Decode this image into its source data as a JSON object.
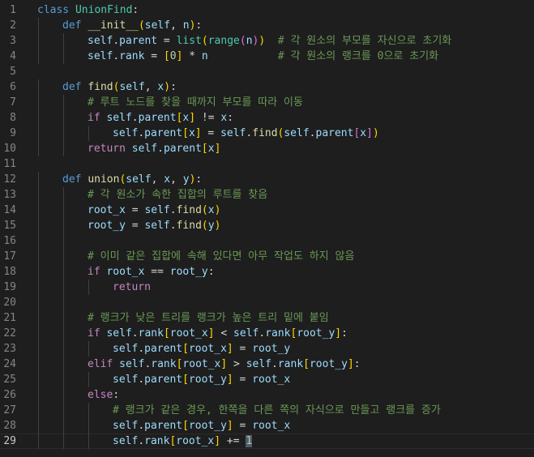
{
  "colors": {
    "background": "#1e1e1e",
    "line_number": "#858585",
    "keyword": "#569cd6",
    "control_keyword": "#c586c0",
    "function": "#dcdcaa",
    "class_name": "#4ec9b0",
    "variable": "#9cdcfe",
    "number": "#b5cea8",
    "comment": "#6a9955",
    "bracket_1": "#ffd700",
    "bracket_2": "#da70d6",
    "bracket_3": "#179fff"
  },
  "current_line": 29,
  "lines": [
    {
      "n": "1",
      "indent": 0,
      "tokens": [
        [
          "kw",
          "class"
        ],
        [
          "op",
          " "
        ],
        [
          "cls",
          "UnionFind"
        ],
        [
          "op",
          ":"
        ]
      ]
    },
    {
      "n": "2",
      "indent": 1,
      "tokens": [
        [
          "kw",
          "def"
        ],
        [
          "op",
          " "
        ],
        [
          "fn",
          "__init__"
        ],
        [
          "b1",
          "("
        ],
        [
          "var",
          "self"
        ],
        [
          "op",
          ", "
        ],
        [
          "var",
          "n"
        ],
        [
          "b1",
          ")"
        ],
        [
          "op",
          ":"
        ]
      ]
    },
    {
      "n": "3",
      "indent": 2,
      "tokens": [
        [
          "var",
          "self"
        ],
        [
          "op",
          "."
        ],
        [
          "var",
          "parent"
        ],
        [
          "op",
          " = "
        ],
        [
          "cls",
          "list"
        ],
        [
          "b1",
          "("
        ],
        [
          "cls",
          "range"
        ],
        [
          "b2",
          "("
        ],
        [
          "var",
          "n"
        ],
        [
          "b2",
          ")"
        ],
        [
          "b1",
          ")"
        ],
        [
          "op",
          "  "
        ],
        [
          "cm",
          "# 각 원소의 부모를 자신으로 초기화"
        ]
      ]
    },
    {
      "n": "4",
      "indent": 2,
      "tokens": [
        [
          "var",
          "self"
        ],
        [
          "op",
          "."
        ],
        [
          "var",
          "rank"
        ],
        [
          "op",
          " = "
        ],
        [
          "b1",
          "["
        ],
        [
          "num",
          "0"
        ],
        [
          "b1",
          "]"
        ],
        [
          "op",
          " * "
        ],
        [
          "var",
          "n"
        ],
        [
          "op",
          "           "
        ],
        [
          "cm",
          "# 각 원소의 랭크를 0으로 초기화"
        ]
      ]
    },
    {
      "n": "5",
      "indent": 0,
      "tokens": []
    },
    {
      "n": "6",
      "indent": 1,
      "tokens": [
        [
          "kw",
          "def"
        ],
        [
          "op",
          " "
        ],
        [
          "fn",
          "find"
        ],
        [
          "b1",
          "("
        ],
        [
          "var",
          "self"
        ],
        [
          "op",
          ", "
        ],
        [
          "var",
          "x"
        ],
        [
          "b1",
          ")"
        ],
        [
          "op",
          ":"
        ]
      ]
    },
    {
      "n": "7",
      "indent": 2,
      "tokens": [
        [
          "cm",
          "# 루트 노드를 찾을 때까지 부모를 따라 이동"
        ]
      ]
    },
    {
      "n": "8",
      "indent": 2,
      "tokens": [
        [
          "kwc",
          "if"
        ],
        [
          "op",
          " "
        ],
        [
          "var",
          "self"
        ],
        [
          "op",
          "."
        ],
        [
          "var",
          "parent"
        ],
        [
          "b1",
          "["
        ],
        [
          "var",
          "x"
        ],
        [
          "b1",
          "]"
        ],
        [
          "op",
          " != "
        ],
        [
          "var",
          "x"
        ],
        [
          "op",
          ":"
        ]
      ]
    },
    {
      "n": "9",
      "indent": 3,
      "tokens": [
        [
          "var",
          "self"
        ],
        [
          "op",
          "."
        ],
        [
          "var",
          "parent"
        ],
        [
          "b1",
          "["
        ],
        [
          "var",
          "x"
        ],
        [
          "b1",
          "]"
        ],
        [
          "op",
          " = "
        ],
        [
          "var",
          "self"
        ],
        [
          "op",
          "."
        ],
        [
          "fn",
          "find"
        ],
        [
          "b1",
          "("
        ],
        [
          "var",
          "self"
        ],
        [
          "op",
          "."
        ],
        [
          "var",
          "parent"
        ],
        [
          "b2",
          "["
        ],
        [
          "var",
          "x"
        ],
        [
          "b2",
          "]"
        ],
        [
          "b1",
          ")"
        ]
      ]
    },
    {
      "n": "10",
      "indent": 2,
      "tokens": [
        [
          "kwc",
          "return"
        ],
        [
          "op",
          " "
        ],
        [
          "var",
          "self"
        ],
        [
          "op",
          "."
        ],
        [
          "var",
          "parent"
        ],
        [
          "b1",
          "["
        ],
        [
          "var",
          "x"
        ],
        [
          "b1",
          "]"
        ]
      ]
    },
    {
      "n": "11",
      "indent": 0,
      "tokens": []
    },
    {
      "n": "12",
      "indent": 1,
      "tokens": [
        [
          "kw",
          "def"
        ],
        [
          "op",
          " "
        ],
        [
          "fn",
          "union"
        ],
        [
          "b1",
          "("
        ],
        [
          "var",
          "self"
        ],
        [
          "op",
          ", "
        ],
        [
          "var",
          "x"
        ],
        [
          "op",
          ", "
        ],
        [
          "var",
          "y"
        ],
        [
          "b1",
          ")"
        ],
        [
          "op",
          ":"
        ]
      ]
    },
    {
      "n": "13",
      "indent": 2,
      "tokens": [
        [
          "cm",
          "# 각 원소가 속한 집합의 루트를 찾음"
        ]
      ]
    },
    {
      "n": "14",
      "indent": 2,
      "tokens": [
        [
          "var",
          "root_x"
        ],
        [
          "op",
          " = "
        ],
        [
          "var",
          "self"
        ],
        [
          "op",
          "."
        ],
        [
          "fn",
          "find"
        ],
        [
          "b1",
          "("
        ],
        [
          "var",
          "x"
        ],
        [
          "b1",
          ")"
        ]
      ]
    },
    {
      "n": "15",
      "indent": 2,
      "tokens": [
        [
          "var",
          "root_y"
        ],
        [
          "op",
          " = "
        ],
        [
          "var",
          "self"
        ],
        [
          "op",
          "."
        ],
        [
          "fn",
          "find"
        ],
        [
          "b1",
          "("
        ],
        [
          "var",
          "y"
        ],
        [
          "b1",
          ")"
        ]
      ]
    },
    {
      "n": "16",
      "indent": 2,
      "tokens": []
    },
    {
      "n": "17",
      "indent": 2,
      "tokens": [
        [
          "cm",
          "# 이미 같은 집합에 속해 있다면 아무 작업도 하지 않음"
        ]
      ]
    },
    {
      "n": "18",
      "indent": 2,
      "tokens": [
        [
          "kwc",
          "if"
        ],
        [
          "op",
          " "
        ],
        [
          "var",
          "root_x"
        ],
        [
          "op",
          " == "
        ],
        [
          "var",
          "root_y"
        ],
        [
          "op",
          ":"
        ]
      ]
    },
    {
      "n": "19",
      "indent": 3,
      "tokens": [
        [
          "kwc",
          "return"
        ]
      ]
    },
    {
      "n": "20",
      "indent": 2,
      "tokens": []
    },
    {
      "n": "21",
      "indent": 2,
      "tokens": [
        [
          "cm",
          "# 랭크가 낮은 트리를 랭크가 높은 트리 밑에 붙임"
        ]
      ]
    },
    {
      "n": "22",
      "indent": 2,
      "tokens": [
        [
          "kwc",
          "if"
        ],
        [
          "op",
          " "
        ],
        [
          "var",
          "self"
        ],
        [
          "op",
          "."
        ],
        [
          "var",
          "rank"
        ],
        [
          "b1",
          "["
        ],
        [
          "var",
          "root_x"
        ],
        [
          "b1",
          "]"
        ],
        [
          "op",
          " < "
        ],
        [
          "var",
          "self"
        ],
        [
          "op",
          "."
        ],
        [
          "var",
          "rank"
        ],
        [
          "b1",
          "["
        ],
        [
          "var",
          "root_y"
        ],
        [
          "b1",
          "]"
        ],
        [
          "op",
          ":"
        ]
      ]
    },
    {
      "n": "23",
      "indent": 3,
      "tokens": [
        [
          "var",
          "self"
        ],
        [
          "op",
          "."
        ],
        [
          "var",
          "parent"
        ],
        [
          "b1",
          "["
        ],
        [
          "var",
          "root_x"
        ],
        [
          "b1",
          "]"
        ],
        [
          "op",
          " = "
        ],
        [
          "var",
          "root_y"
        ]
      ]
    },
    {
      "n": "24",
      "indent": 2,
      "tokens": [
        [
          "kwc",
          "elif"
        ],
        [
          "op",
          " "
        ],
        [
          "var",
          "self"
        ],
        [
          "op",
          "."
        ],
        [
          "var",
          "rank"
        ],
        [
          "b1",
          "["
        ],
        [
          "var",
          "root_x"
        ],
        [
          "b1",
          "]"
        ],
        [
          "op",
          " > "
        ],
        [
          "var",
          "self"
        ],
        [
          "op",
          "."
        ],
        [
          "var",
          "rank"
        ],
        [
          "b1",
          "["
        ],
        [
          "var",
          "root_y"
        ],
        [
          "b1",
          "]"
        ],
        [
          "op",
          ":"
        ]
      ]
    },
    {
      "n": "25",
      "indent": 3,
      "tokens": [
        [
          "var",
          "self"
        ],
        [
          "op",
          "."
        ],
        [
          "var",
          "parent"
        ],
        [
          "b1",
          "["
        ],
        [
          "var",
          "root_y"
        ],
        [
          "b1",
          "]"
        ],
        [
          "op",
          " = "
        ],
        [
          "var",
          "root_x"
        ]
      ]
    },
    {
      "n": "26",
      "indent": 2,
      "tokens": [
        [
          "kwc",
          "else"
        ],
        [
          "op",
          ":"
        ]
      ]
    },
    {
      "n": "27",
      "indent": 3,
      "tokens": [
        [
          "cm",
          "# 랭크가 같은 경우, 한쪽을 다른 쪽의 자식으로 만들고 랭크를 증가"
        ]
      ]
    },
    {
      "n": "28",
      "indent": 3,
      "tokens": [
        [
          "var",
          "self"
        ],
        [
          "op",
          "."
        ],
        [
          "var",
          "parent"
        ],
        [
          "b1",
          "["
        ],
        [
          "var",
          "root_y"
        ],
        [
          "b1",
          "]"
        ],
        [
          "op",
          " = "
        ],
        [
          "var",
          "root_x"
        ]
      ]
    },
    {
      "n": "29",
      "indent": 3,
      "tokens": [
        [
          "var",
          "self"
        ],
        [
          "op",
          "."
        ],
        [
          "var",
          "rank"
        ],
        [
          "b1",
          "["
        ],
        [
          "var",
          "root_x"
        ],
        [
          "b1",
          "]"
        ],
        [
          "op",
          " += "
        ],
        [
          "num",
          "1",
          "cursor"
        ]
      ]
    }
  ]
}
